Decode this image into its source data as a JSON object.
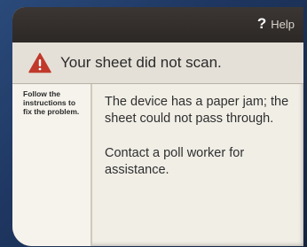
{
  "topbar": {
    "help_icon_char": "?",
    "help_label": "Help"
  },
  "alert": {
    "icon": "warning-triangle-icon",
    "icon_color": "#c0392b",
    "message": "Your sheet did not scan."
  },
  "sidebar": {
    "instructions": "Follow the instructions to fix the problem."
  },
  "main": {
    "paragraph_1": "The device has a paper jam; the sheet could not pass through.",
    "paragraph_2": "Contact a poll worker for assistance."
  }
}
